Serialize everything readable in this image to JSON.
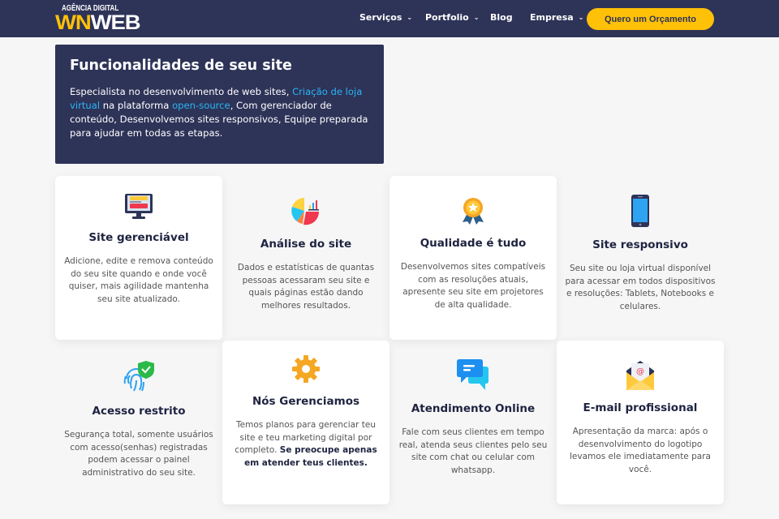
{
  "brand": {
    "tagline": "AGÊNCIA DIGITAL",
    "name_part1": "WN",
    "name_part2": "WEB"
  },
  "nav": {
    "items": [
      {
        "label": "Serviços",
        "dropdown": true
      },
      {
        "label": "Portfolio",
        "dropdown": true
      },
      {
        "label": "Blog",
        "dropdown": false
      },
      {
        "label": "Empresa",
        "dropdown": true
      }
    ],
    "cta": "Quero um Orçamento"
  },
  "hero": {
    "title": "Funcionalidades de seu site",
    "text1": "Especialista no desenvolvimento de web sites, ",
    "link1": "Criação de loja virtual",
    "text2": " na plataforma ",
    "link2": "open-source",
    "text3": ", Com gerenciador de conteúdo, Desenvolvemos sites responsivos, Equipe preparada para ajudar em todas as etapas."
  },
  "features": [
    {
      "title": "Site gerenciável",
      "desc": "Adicione, edite e remova conteúdo do seu site quando e onde você quiser, mais agilidade mantenha seu site atualizado.",
      "icon": "monitor-icon"
    },
    {
      "title": "Análise do site",
      "desc": "Dados e estatísticas de quantas pessoas acessaram seu site e quais páginas estão dando melhores resultados.",
      "icon": "pie-chart-icon"
    },
    {
      "title": "Qualidade é tudo",
      "desc": "Desenvolvemos sites compatíveis com as resoluções atuais, apresente seu site em projetores de alta qualidade.",
      "icon": "award-medal-icon"
    },
    {
      "title": "Site responsivo",
      "desc": "Seu site ou loja virtual disponível para acessar em todos dispositivos e resoluções: Tablets, Notebooks e celulares.",
      "icon": "smartphone-icon"
    },
    {
      "title": "Acesso restrito",
      "desc": "Segurança total, somente usuários com acesso(senhas) registradas podem acessar o painel administrativo do seu site.",
      "icon": "fingerprint-shield-icon"
    },
    {
      "title": "Nós Gerenciamos",
      "desc": "Temos planos para gerenciar teu site e teu marketing digital por completo. ",
      "desc_bold": "Se preocupe apenas em atender teus clientes.",
      "icon": "gear-icon"
    },
    {
      "title": "Atendimento Online",
      "desc": "Fale com seus clientes em tempo real, atenda seus clientes pelo seu site com chat ou celular com whatsapp.",
      "icon": "chat-bubbles-icon"
    },
    {
      "title": "E-mail profissional",
      "desc": "Apresentação da marca: após o desenvolvimento do logotipo levamos ele imediatamente para você.",
      "icon": "email-envelope-icon"
    }
  ],
  "colors": {
    "navy": "#2e3358",
    "accent": "#ffc107",
    "link": "#29b6f6"
  }
}
